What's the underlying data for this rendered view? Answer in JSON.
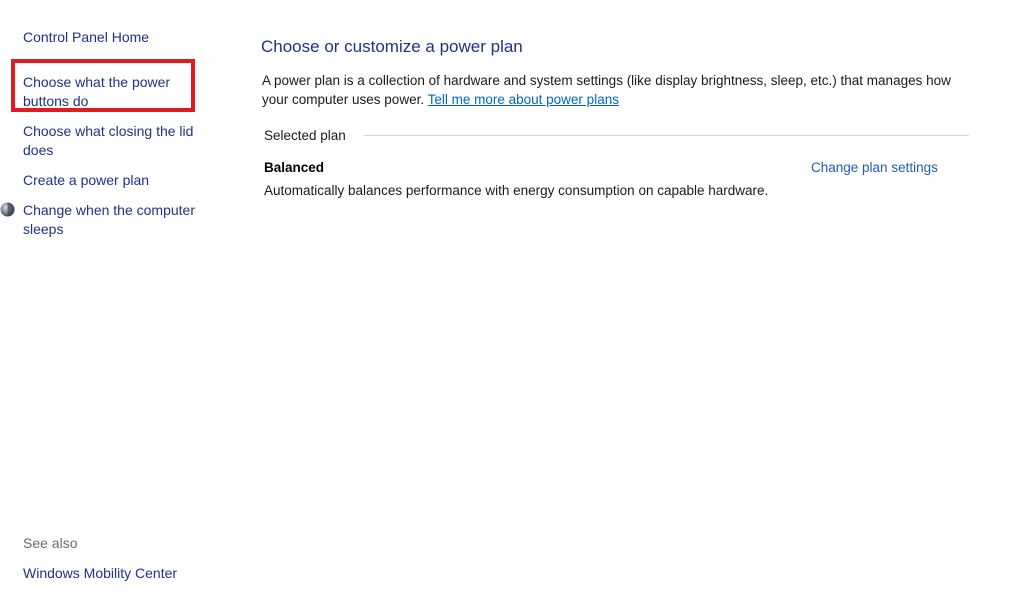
{
  "sidebar": {
    "home_label": "Control Panel Home",
    "items": [
      {
        "label": "Choose what the power buttons do"
      },
      {
        "label": "Choose what closing the lid does"
      },
      {
        "label": "Create a power plan"
      },
      {
        "label": "Change when the computer sleeps",
        "icon": "shield-icon"
      }
    ],
    "see_also_label": "See also",
    "see_also_links": [
      {
        "label": "Windows Mobility Center"
      }
    ]
  },
  "main": {
    "title": "Choose or customize a power plan",
    "description": "A power plan is a collection of hardware and system settings (like display brightness, sleep, etc.) that manages how your computer uses power.",
    "learn_more_link": "Tell me more about power plans",
    "selected_plan_label": "Selected plan",
    "plan": {
      "name": "Balanced",
      "description": "Automatically balances performance with energy consumption on capable hardware.",
      "change_settings_label": "Change plan settings"
    }
  },
  "colors": {
    "link": "#1e3287",
    "highlight": "#e11b22",
    "inline_link": "#0066cc"
  }
}
